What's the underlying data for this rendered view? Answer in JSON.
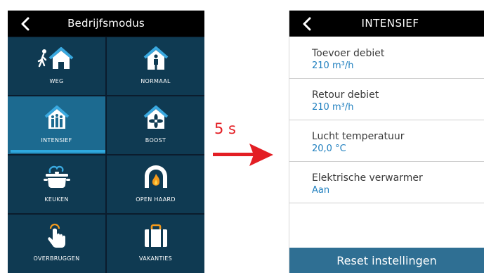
{
  "left_screen": {
    "title": "Bedrijfsmodus",
    "back_icon": "chevron-left-icon",
    "modes": [
      {
        "label": "WEG",
        "icon": "walking-person-house-icon",
        "active": false
      },
      {
        "label": "NORMAAL",
        "icon": "person-house-icon",
        "active": false
      },
      {
        "label": "INTENSIEF",
        "icon": "family-house-icon",
        "active": true
      },
      {
        "label": "BOOST",
        "icon": "fan-house-icon",
        "active": false
      },
      {
        "label": "KEUKEN",
        "icon": "cooking-pot-icon",
        "active": false
      },
      {
        "label": "OPEN HAARD",
        "icon": "fireplace-icon",
        "active": false
      },
      {
        "label": "OVERBRUGGEN",
        "icon": "finger-tap-icon",
        "active": false
      },
      {
        "label": "VAKANTIES",
        "icon": "suitcase-icon",
        "active": false
      }
    ]
  },
  "transition": {
    "label": "5 s",
    "icon": "arrow-right-icon"
  },
  "right_screen": {
    "title": "INTENSIEF",
    "back_icon": "chevron-left-icon",
    "settings": [
      {
        "label": "Toevoer debiet",
        "value": "210 m³/h"
      },
      {
        "label": "Retour debiet",
        "value": "210 m³/h"
      },
      {
        "label": "Lucht temperatuur",
        "value": "20,0 °C"
      },
      {
        "label": "Elektrische verwarmer",
        "value": "Aan"
      }
    ],
    "reset_label": "Reset instellingen"
  },
  "colors": {
    "header_bg": "#000000",
    "tile_bg": "#0f3a52",
    "tile_active_bg": "#1c6a90",
    "active_underline": "#2ea8de",
    "arrow": "#e31e24",
    "value_text": "#1f7fbf",
    "reset_bg": "#2f6f93"
  }
}
